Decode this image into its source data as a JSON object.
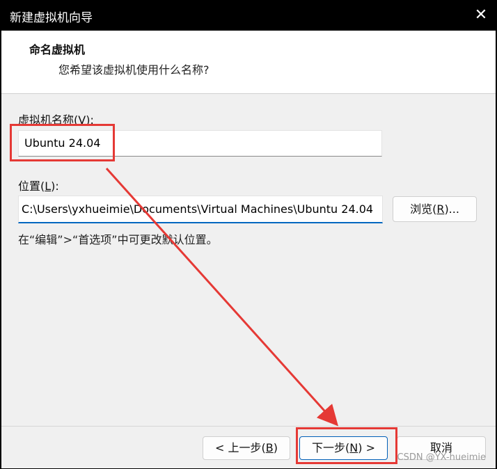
{
  "window": {
    "title": "新建虚拟机向导"
  },
  "header": {
    "heading": "命名虚拟机",
    "subheading": "您希望该虚拟机使用什么名称?"
  },
  "form": {
    "name_label_prefix": "虚拟机名称(",
    "name_label_key": "V",
    "name_label_suffix": "):",
    "name_value": "Ubuntu 24.04",
    "location_label_prefix": "位置(",
    "location_label_key": "L",
    "location_label_suffix": "):",
    "location_value": "C:\\Users\\yxhueimie\\Documents\\Virtual Machines\\Ubuntu 24.04",
    "browse_prefix": "浏览(",
    "browse_key": "R",
    "browse_suffix": ")...",
    "hint": "在“编辑”>“首选项”中可更改默认位置。"
  },
  "footer": {
    "back_prefix": "< 上一步(",
    "back_key": "B",
    "back_suffix": ")",
    "next_prefix": "下一步(",
    "next_key": "N",
    "next_suffix": ") >",
    "cancel": "取消"
  },
  "annotation": {
    "color": "#e53935"
  },
  "watermark": "CSDN @YX-hueimie",
  "icons": {
    "close": "close-icon"
  }
}
